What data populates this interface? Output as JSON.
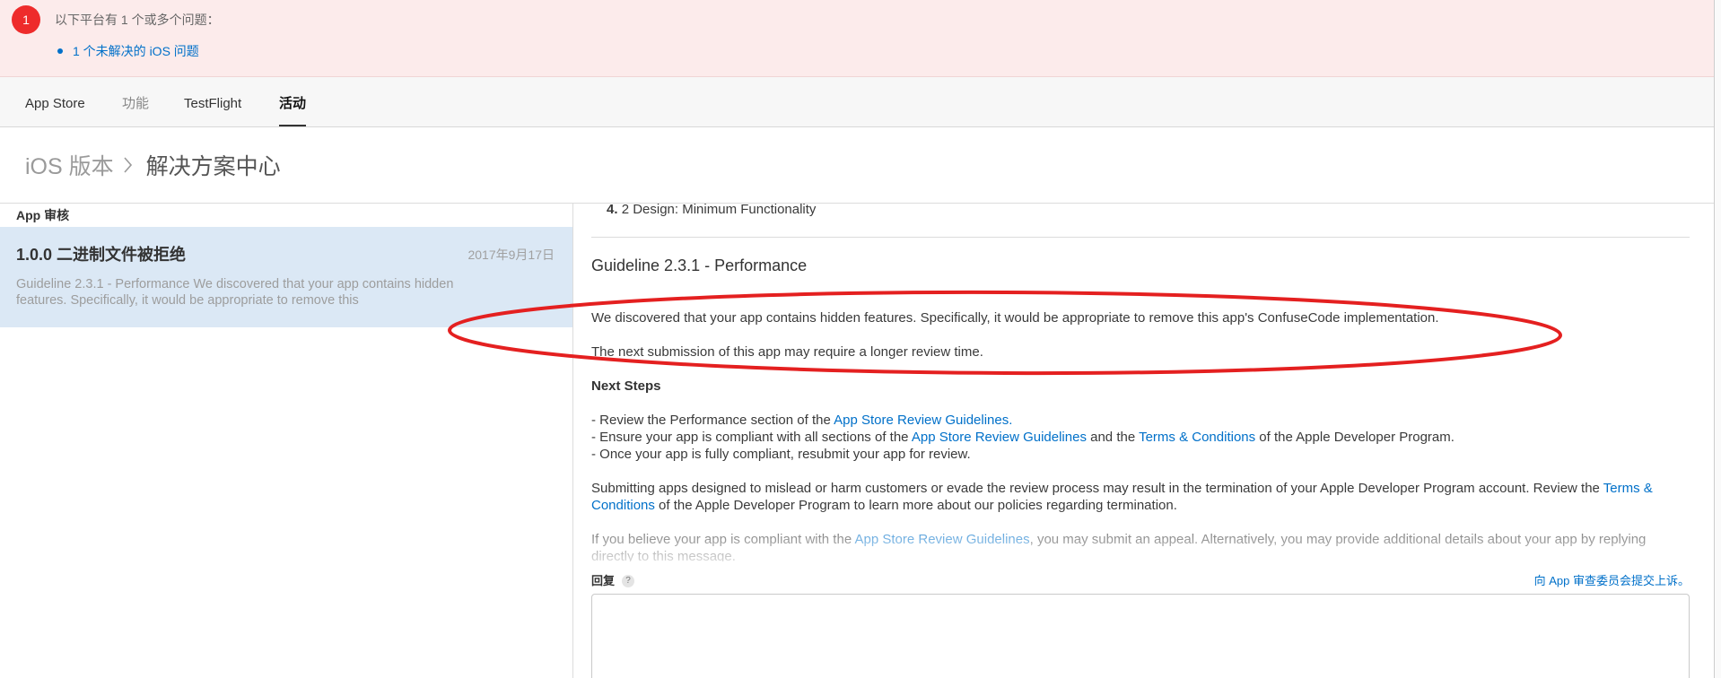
{
  "banner": {
    "badge_count": "1",
    "message": "以下平台有 1 个或多个问题：",
    "issue_link": "1 个未解决的 iOS 问题"
  },
  "tabs": [
    {
      "label": "App Store",
      "active": false
    },
    {
      "label": "功能",
      "active": false
    },
    {
      "label": "TestFlight",
      "active": false
    },
    {
      "label": "活动",
      "active": true
    }
  ],
  "breadcrumb": {
    "parent": "iOS 版本",
    "current": "解决方案中心"
  },
  "sidebar": {
    "header": "App 审核",
    "items": [
      {
        "title": "1.0.0 二进制文件被拒绝",
        "date": "2017年9月17日",
        "preview": "Guideline 2.3.1 - Performance We discovered that your app contains hidden features. Specifically, it would be appropriate to remove this",
        "selected": true
      }
    ]
  },
  "message": {
    "prev_item": {
      "number": "4.",
      "text": "2 Design: Minimum Functionality"
    },
    "heading": "Guideline 2.3.1 - Performance",
    "findings": "We discovered that your app contains hidden features. Specifically, it would be appropriate to remove this app's ConfuseCode implementation.",
    "review_time_note": "The next submission of this app may require a longer review time.",
    "next_steps_title": "Next Steps",
    "steps": [
      [
        "- Review the Performance section of the ",
        "App Store Review Guidelines."
      ],
      [
        "- Ensure your app is compliant with all sections of the ",
        "App Store Review Guidelines",
        " and the ",
        "Terms & Conditions",
        " of the Apple Developer Program."
      ],
      [
        "- Once your app is fully compliant, resubmit your app for review."
      ]
    ],
    "termination_notice": [
      "Submitting apps designed to mislead or harm customers or evade the review process may result in the termination of your Apple Developer Program account. Review the ",
      "Terms & Conditions",
      " of the Apple Developer Program to learn more about our policies regarding termination."
    ],
    "appeal_notice": [
      "If you believe your app is compliant with the ",
      "App Store Review Guidelines",
      ", you may submit an appeal. Alternatively, you may provide additional details about your app by replying directly to this message."
    ]
  },
  "reply": {
    "label": "回复",
    "help_glyph": "?",
    "appeal_link": "向 App 审查委员会提交上诉。",
    "value": ""
  },
  "icons": {
    "banner_alert": "alert-badge",
    "breadcrumb_separator": "chevron-right-icon",
    "reply_help": "help-icon"
  },
  "colors": {
    "link": "#0070c9",
    "badge": "#ee2b2b",
    "banner_bg": "#fcebeb",
    "selected_bg": "#dbe8f5",
    "annotation": "#e42020"
  }
}
